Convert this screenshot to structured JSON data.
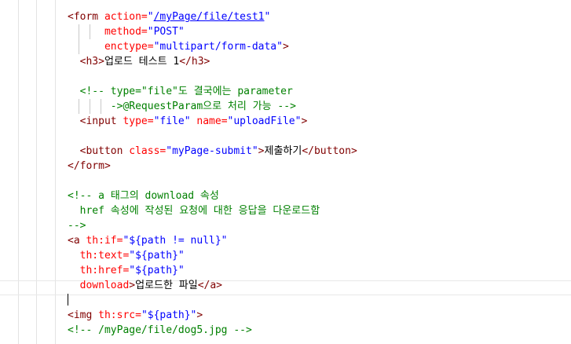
{
  "editor": {
    "lines": [
      [
        {
          "t": "<form ",
          "c": "tag"
        },
        {
          "t": "action=",
          "c": "attr"
        },
        {
          "t": "\"",
          "c": "val"
        },
        {
          "t": "/myPage/file/test1",
          "c": "val",
          "u": true
        },
        {
          "t": "\"",
          "c": "val"
        }
      ],
      [
        {
          "t": "      ",
          "c": "txt"
        },
        {
          "t": "method=",
          "c": "attr"
        },
        {
          "t": "\"POST\"",
          "c": "val"
        }
      ],
      [
        {
          "t": "      ",
          "c": "txt"
        },
        {
          "t": "enctype=",
          "c": "attr"
        },
        {
          "t": "\"multipart/form-data\"",
          "c": "val"
        },
        {
          "t": ">",
          "c": "tag"
        }
      ],
      [
        {
          "t": "  ",
          "c": "txt"
        },
        {
          "t": "<h3>",
          "c": "tag"
        },
        {
          "t": "업로드 테스트 1",
          "c": "txt"
        },
        {
          "t": "</h3>",
          "c": "tag"
        }
      ],
      [],
      [
        {
          "t": "  ",
          "c": "txt"
        },
        {
          "t": "<!-- type=\"file\"도 결국에는 parameter",
          "c": "cmt"
        }
      ],
      [
        {
          "t": "       ->@RequestParam으로 처리 가능 -->",
          "c": "cmt"
        }
      ],
      [
        {
          "t": "  ",
          "c": "txt"
        },
        {
          "t": "<input ",
          "c": "tag"
        },
        {
          "t": "type=",
          "c": "attr"
        },
        {
          "t": "\"file\" ",
          "c": "val"
        },
        {
          "t": "name=",
          "c": "attr"
        },
        {
          "t": "\"uploadFile\"",
          "c": "val"
        },
        {
          "t": ">",
          "c": "tag"
        }
      ],
      [],
      [
        {
          "t": "  ",
          "c": "txt"
        },
        {
          "t": "<button ",
          "c": "tag"
        },
        {
          "t": "class=",
          "c": "attr"
        },
        {
          "t": "\"myPage-submit\"",
          "c": "val"
        },
        {
          "t": ">",
          "c": "tag"
        },
        {
          "t": "제출하기",
          "c": "txt"
        },
        {
          "t": "</button>",
          "c": "tag"
        }
      ],
      [
        {
          "t": "</form>",
          "c": "tag"
        }
      ],
      [],
      [
        {
          "t": "<!-- a 태그의 download 속성",
          "c": "cmt"
        }
      ],
      [
        {
          "t": "  href 속성에 작성된 요청에 대한 응답을 다운로드함",
          "c": "cmt"
        }
      ],
      [
        {
          "t": "-->",
          "c": "cmt"
        }
      ],
      [
        {
          "t": "<a ",
          "c": "tag"
        },
        {
          "t": "th:if=",
          "c": "attr"
        },
        {
          "t": "\"${path != null}\"",
          "c": "val"
        }
      ],
      [
        {
          "t": "  ",
          "c": "txt"
        },
        {
          "t": "th:text=",
          "c": "attr"
        },
        {
          "t": "\"${path}\"",
          "c": "val"
        }
      ],
      [
        {
          "t": "  ",
          "c": "txt"
        },
        {
          "t": "th:href=",
          "c": "attr"
        },
        {
          "t": "\"${path}\"",
          "c": "val"
        }
      ],
      [
        {
          "t": "  ",
          "c": "txt"
        },
        {
          "t": "download",
          "c": "attr"
        },
        {
          "t": ">",
          "c": "tag"
        },
        {
          "t": "업로드한 파일",
          "c": "txt"
        },
        {
          "t": "</a>",
          "c": "tag"
        }
      ],
      [],
      [
        {
          "t": "<img ",
          "c": "tag"
        },
        {
          "t": "th:src=",
          "c": "attr"
        },
        {
          "t": "\"${path}\"",
          "c": "val"
        },
        {
          "t": ">",
          "c": "tag"
        }
      ],
      [
        {
          "t": "<!-- /myPage/file/dog5.jpg -->",
          "c": "cmt"
        }
      ]
    ],
    "cursor_line": 19
  }
}
